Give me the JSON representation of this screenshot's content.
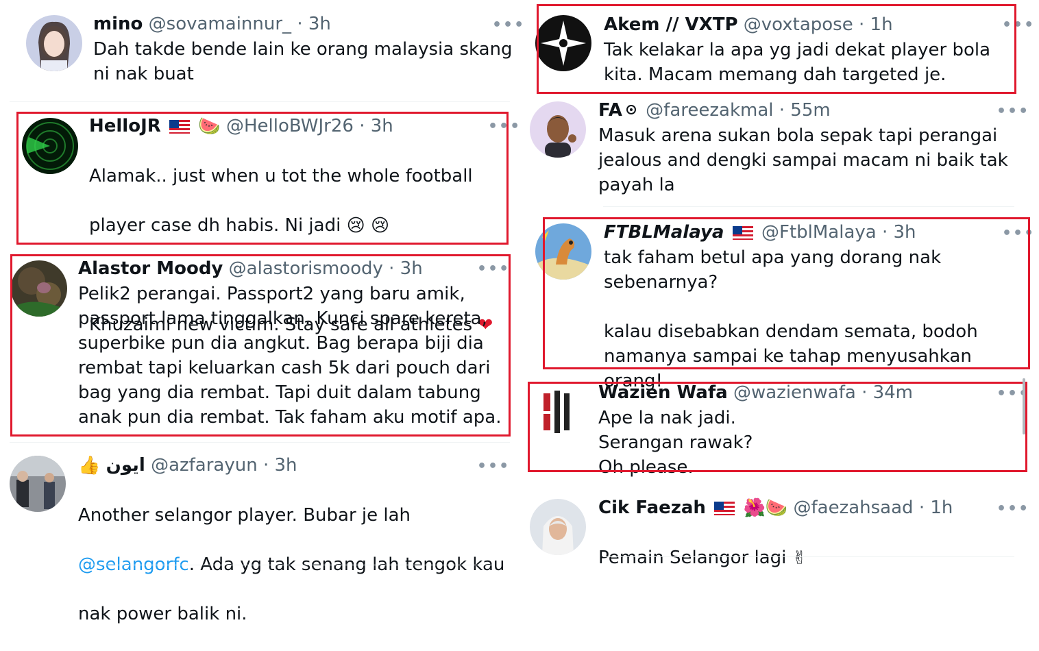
{
  "left": [
    {
      "name": "mino",
      "handle": "@sovamainnur_",
      "time": "· 3h",
      "more": "•••",
      "body": "Dah takde bende lain ke orang malaysia skang\nni nak buat"
    },
    {
      "name": "HelloJR",
      "handle": "@HelloBWJr26",
      "time": "· 3h",
      "more": "•••",
      "body1": "Alamak.. just when u tot the whole football",
      "body2": "player case dh habis. Ni jadi",
      "body3": "Khuzaimi new victim. Stay safe all athletes"
    },
    {
      "name": "Alastor Moody",
      "handle": "@alastorismoody",
      "time": "· 3h",
      "more": "•••",
      "body": "Pelik2 perangai. Passport2 yang baru amik,\npassport lama tinggalkan. Kunci spare kereta,\nsuperbike pun dia angkut. Bag berapa biji dia\nrembat tapi keluarkan cash 5k dari pouch dari\nbag yang dia rembat. Tapi duit dalam tabung\nanak pun dia rembat. Tak faham aku motif apa."
    },
    {
      "name": "ايون",
      "handle": "@azfarayun",
      "time": "· 3h",
      "more": "•••",
      "body1": "Another selangor player. Bubar je lah",
      "mention": "@selangorfc",
      "body2": ". Ada yg tak senang lah tengok kau",
      "body3": "nak power balik ni."
    }
  ],
  "right": [
    {
      "name": "Akem // VXTP",
      "handle": "@voxtapose",
      "time": "· 1h",
      "more": "•••",
      "body": "Tak kelakar la apa yg jadi dekat player bola\nkita. Macam memang dah targeted je."
    },
    {
      "name": "FA",
      "handle": "@fareezakmal",
      "time": "· 55m",
      "more": "•••",
      "body": "Masuk arena sukan bola sepak tapi perangai\njealous and dengki sampai macam ni baik tak\npayah la"
    },
    {
      "name": "FTBLMalaya",
      "handle": "@FtblMalaya",
      "time": "· 3h",
      "more": "•••",
      "body": "tak faham betul apa yang dorang nak\nsebenarnya?\n\nkalau disebabkan dendam semata, bodoh\nnamanya sampai ke tahap menyusahkan orang!"
    },
    {
      "name": "Wazien Wafa",
      "handle": "@wazienwafa",
      "time": "· 34m",
      "more": "•••",
      "body": "Ape la nak jadi.\nSerangan rawak?\nOh please."
    },
    {
      "name": "Cik Faezah",
      "handle": "@faezahsaad",
      "time": "· 1h",
      "more": "•••",
      "body": "Pemain Selangor lagi"
    }
  ],
  "colors": {
    "highlight": "#e0182d",
    "mention": "#1d9bf0",
    "handle": "#536471"
  },
  "icons": [
    "more-icon",
    "malaysia-flag-icon",
    "watermelon-icon",
    "crying-face-icon",
    "heart-icon",
    "thumbs-up-icon",
    "verified-badge-icon",
    "hibiscus-icon",
    "victory-hand-icon"
  ]
}
